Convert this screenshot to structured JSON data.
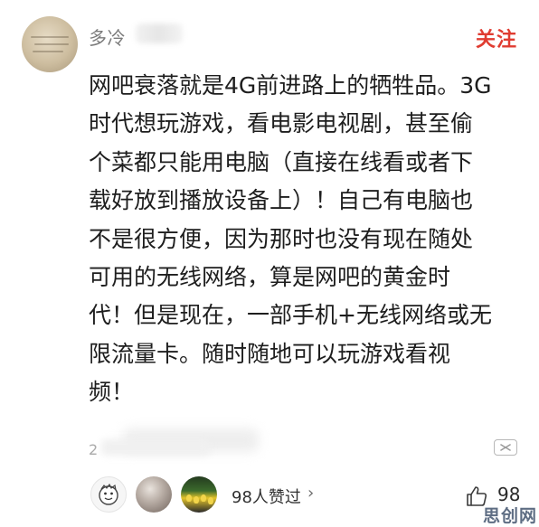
{
  "header": {
    "username": "多冷",
    "follow_label": "关注"
  },
  "comment": {
    "lines": [
      "网吧衰落就是4G前进路上的牺牲品。3G",
      "时代想玩游戏，看电影电视剧，甚至偷",
      "个菜都只能用电脑（直接在线看或者下",
      "载好放到播放设备上）！自己有电脑也",
      "不是很方便，因为那时也没有现在随处",
      "可用的无线网络，算是网吧的黄金时",
      "代！但是现在，一部手机+无线网络或无",
      "限流量卡。随时随地可以玩游戏看视",
      "频！"
    ]
  },
  "meta": {
    "date": "2"
  },
  "footer": {
    "likes_text": "98人赞过",
    "likes_arrow": "›",
    "like_count": "98"
  },
  "watermark": "思创网",
  "colors": {
    "follow": "#e03c31",
    "text": "#1e1e1e",
    "secondary": "#7b7b7b"
  },
  "icons": {
    "more": "more-icon",
    "like": "thumb-up-icon",
    "chevron": "chevron-right-icon"
  }
}
